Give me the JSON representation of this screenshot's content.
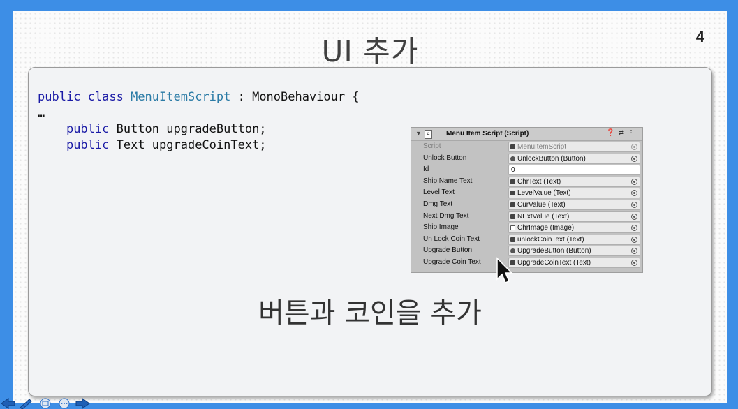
{
  "slide": {
    "title": "UI 추가",
    "page_number": "4",
    "caption": "버튼과 코인을 추가"
  },
  "code": {
    "line1_kw": "public class",
    "line1_cls": "MenuItemScript",
    "line1_rest": " : MonoBehaviour {",
    "line2": "…",
    "line3_kw": "public",
    "line3_rest": " Button upgradeButton;",
    "line4_kw": "public",
    "line4_rest": " Text upgradeCoinText;"
  },
  "inspector": {
    "header": "Menu Item Script (Script)",
    "rows": [
      {
        "label": "Script",
        "value": "MenuItemScript",
        "icon": "script-icon"
      },
      {
        "label": "Unlock Button",
        "value": "UnlockButton (Button)",
        "icon": "button-icon"
      },
      {
        "label": "Id",
        "value": "0",
        "icon": ""
      },
      {
        "label": "Ship Name Text",
        "value": "ChrText (Text)",
        "icon": "text-icon"
      },
      {
        "label": "Level Text",
        "value": "LevelValue (Text)",
        "icon": "text-icon"
      },
      {
        "label": "Dmg Text",
        "value": "CurValue (Text)",
        "icon": "text-icon"
      },
      {
        "label": "Next Dmg Text",
        "value": "NExtValue (Text)",
        "icon": "text-icon"
      },
      {
        "label": "Ship Image",
        "value": "ChrImage (Image)",
        "icon": "image-icon"
      },
      {
        "label": "Un Lock Coin Text",
        "value": "unlockCoinText (Text)",
        "icon": "text-icon"
      },
      {
        "label": "Upgrade Button",
        "value": "UpgradeButton (Button)",
        "icon": "button-icon"
      },
      {
        "label": "Upgrade Coin Text",
        "value": "UpgradeCoinText (Text)",
        "icon": "text-icon"
      }
    ]
  },
  "colors": {
    "frame": "#3d8ee6",
    "keyword": "#1a1aa6",
    "class_name": "#2b7ba6"
  }
}
